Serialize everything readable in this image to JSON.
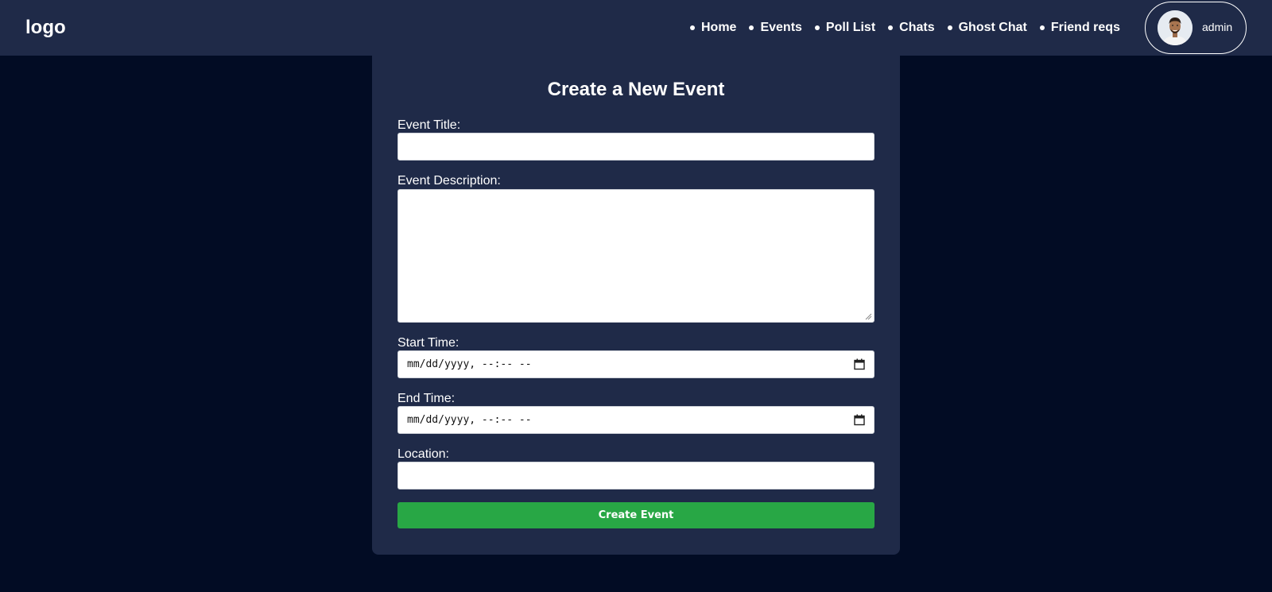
{
  "header": {
    "logo": "logo",
    "nav_items": [
      {
        "label": "Home"
      },
      {
        "label": "Events"
      },
      {
        "label": "Poll List"
      },
      {
        "label": "Chats"
      },
      {
        "label": "Ghost Chat"
      },
      {
        "label": "Friend reqs"
      }
    ],
    "profile": {
      "username": "admin",
      "avatar_icon": "user-avatar"
    }
  },
  "form": {
    "title": "Create a New Event",
    "fields": {
      "title_label": "Event Title:",
      "title_value": "",
      "description_label": "Event Description:",
      "description_value": "",
      "start_label": "Start Time:",
      "start_placeholder": "mm/dd/yyyy, --:-- --",
      "end_label": "End Time:",
      "end_placeholder": "mm/dd/yyyy, --:-- --",
      "location_label": "Location:",
      "location_value": ""
    },
    "submit_label": "Create Event",
    "icons": {
      "date_picker": "calendar-icon"
    }
  },
  "colors": {
    "page_background": "#020c24",
    "panel_background": "#1f2a48",
    "submit_button": "#28a745",
    "text": "#ffffff"
  }
}
